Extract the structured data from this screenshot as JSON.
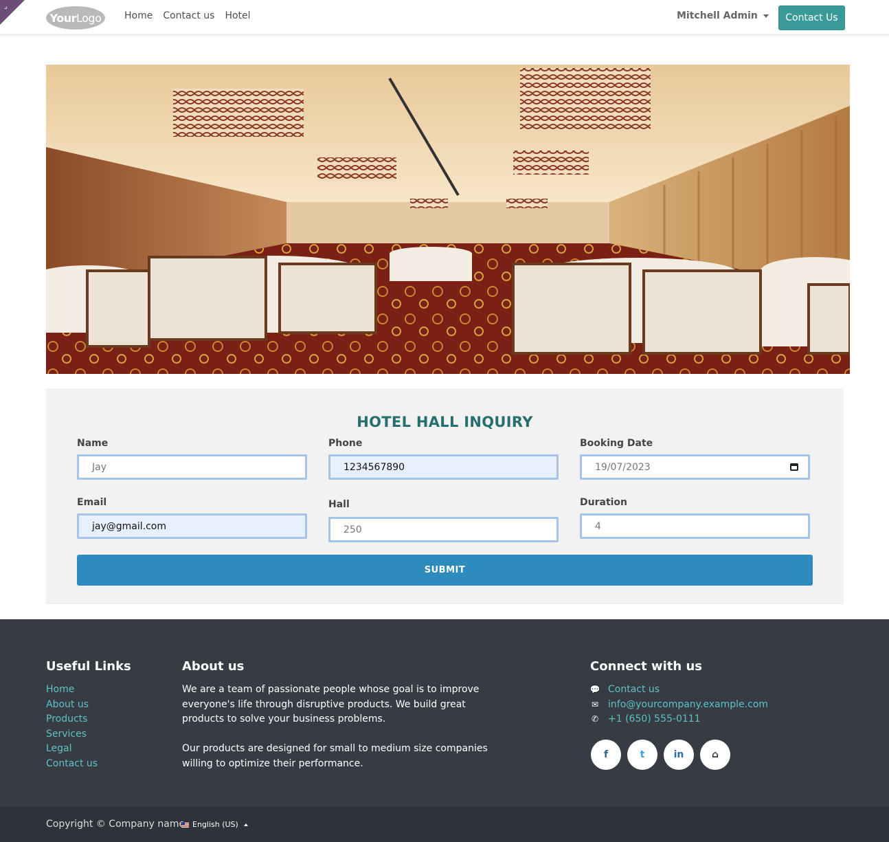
{
  "header": {
    "logo": {
      "bold": "Your",
      "light": "Logo"
    },
    "nav": [
      "Home",
      "Contact us",
      "Hotel"
    ],
    "user": "Mitchell Admin",
    "cta": "Contact Us"
  },
  "hero": {
    "icon": "banquet-hall-photo"
  },
  "form": {
    "title": "HOTEL HALL INQUIRY",
    "name_label": "Name",
    "name_value": "Jay",
    "phone_label": "Phone",
    "phone_value": "1234567890",
    "date_label": "Booking Date",
    "date_value": "19/07/2023",
    "email_label": "Email",
    "email_value": "jay@gmail.com",
    "hall_label": "Hall",
    "hall_value": "250",
    "duration_label": "Duration",
    "duration_value": "4",
    "submit": "SUBMIT"
  },
  "footer": {
    "useful_title": "Useful Links",
    "links": [
      "Home",
      "About us",
      "Products",
      "Services",
      "Legal",
      "Contact us"
    ],
    "about_title": "About us",
    "about_p1": "We are a team of passionate people whose goal is to improve everyone's life through disruptive products. We build great products to solve your business problems.",
    "about_p2": "Our products are designed for small to medium size companies willing to optimize their performance.",
    "connect_title": "Connect with us",
    "contact": "Contact us",
    "email": "info@yourcompany.example.com",
    "phone": "+1 (650) 555-0111",
    "socials": [
      "f",
      "t",
      "in",
      "⌂"
    ]
  },
  "bottom": {
    "copyright": "Copyright © Company name",
    "language": "English (US)"
  }
}
